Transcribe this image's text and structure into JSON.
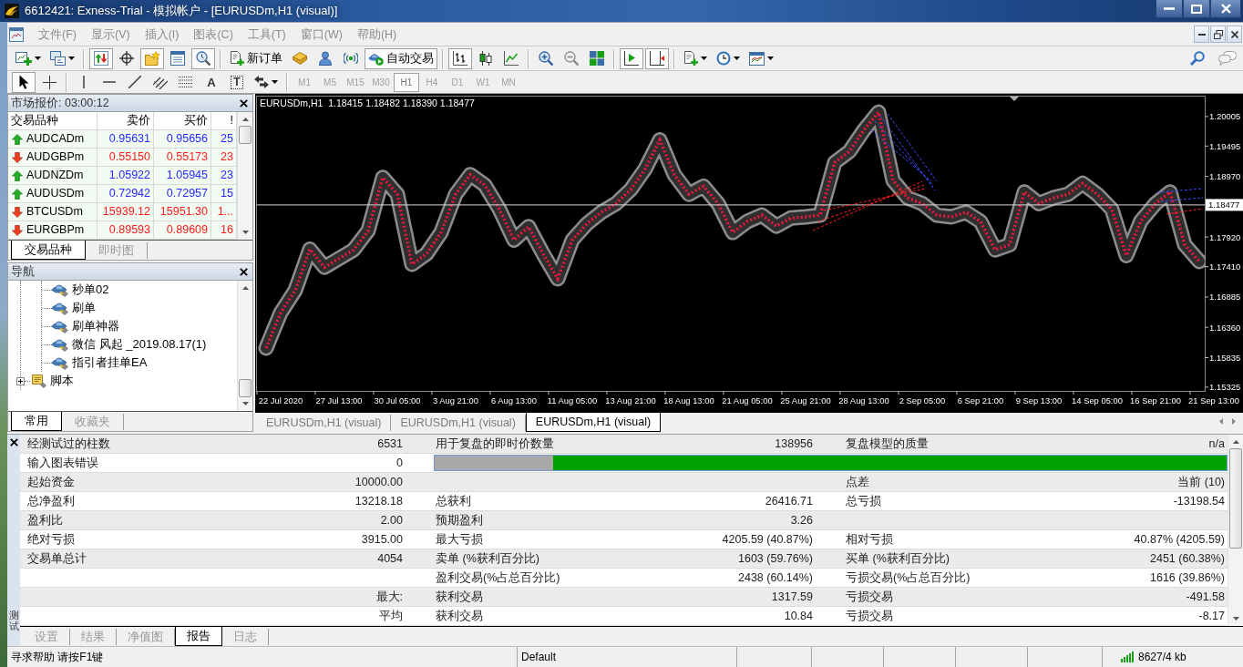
{
  "window": {
    "title": "6612421: Exness-Trial - 模拟帐户 - [EURUSDm,H1 (visual)]"
  },
  "menu": [
    "文件(F)",
    "显示(V)",
    "插入(I)",
    "图表(C)",
    "工具(T)",
    "窗口(W)",
    "帮助(H)"
  ],
  "toolbar": [
    [
      {
        "kind": "menu"
      },
      {
        "kind": "menu"
      }
    ],
    [
      {
        "kind": "toggle",
        "pressed": true
      },
      {
        "kind": "toggle",
        "pressed": false
      },
      {
        "kind": "toggle",
        "pressed": true
      },
      {
        "kind": "toggle",
        "pressed": false
      },
      {
        "kind": "toggle",
        "pressed": true
      }
    ],
    [
      {
        "kind": "button",
        "label": "新订单"
      },
      {
        "kind": "button"
      },
      {
        "kind": "button"
      },
      {
        "kind": "button"
      },
      {
        "kind": "toggle",
        "label": "自动交易",
        "pressed": true
      }
    ],
    [
      {
        "kind": "toggle",
        "pressed": true
      },
      {
        "kind": "toggle",
        "pressed": false
      },
      {
        "kind": "toggle",
        "pressed": false
      }
    ],
    [
      {
        "kind": "button"
      },
      {
        "kind": "button"
      },
      {
        "kind": "button"
      }
    ],
    [
      {
        "kind": "toggle",
        "pressed": true
      },
      {
        "kind": "toggle",
        "pressed": true
      }
    ],
    [
      {
        "kind": "menu"
      },
      {
        "kind": "menu"
      },
      {
        "kind": "menu"
      }
    ]
  ],
  "drawing_toolbar": {
    "tools": [
      [
        {
          "kind": "toggle",
          "pressed": true
        },
        {
          "kind": "toggle",
          "pressed": false
        }
      ],
      [
        {
          "kind": "button"
        },
        {
          "kind": "button"
        },
        {
          "kind": "button"
        },
        {
          "kind": "button"
        },
        {
          "kind": "button"
        },
        {
          "kind": "button",
          "label": "A"
        },
        {
          "kind": "button",
          "label": "T"
        },
        {
          "kind": "menu"
        }
      ]
    ],
    "periods": [
      {
        "label": "M1",
        "selected": false
      },
      {
        "label": "M5",
        "selected": false
      },
      {
        "label": "M15",
        "selected": false
      },
      {
        "label": "M30",
        "selected": false
      },
      {
        "label": "H1",
        "selected": true
      },
      {
        "label": "H4",
        "selected": false
      },
      {
        "label": "D1",
        "selected": false
      },
      {
        "label": "W1",
        "selected": false
      },
      {
        "label": "MN",
        "selected": false
      }
    ]
  },
  "market_watch": {
    "title": "市场报价: 03:00:12",
    "columns": [
      "交易品种",
      "卖价",
      "买价",
      "!"
    ],
    "rows": [
      {
        "symbol": "AUDCADm",
        "bid": "0.95631",
        "ask": "0.95656",
        "spread": "25",
        "rising": true
      },
      {
        "symbol": "AUDGBPm",
        "bid": "0.55150",
        "ask": "0.55173",
        "spread": "23",
        "rising": false
      },
      {
        "symbol": "AUDNZDm",
        "bid": "1.05922",
        "ask": "1.05945",
        "spread": "23",
        "rising": true
      },
      {
        "symbol": "AUDUSDm",
        "bid": "0.72942",
        "ask": "0.72957",
        "spread": "15",
        "rising": true
      },
      {
        "symbol": "BTCUSDm",
        "bid": "15939.12",
        "ask": "15951.30",
        "spread": "1...",
        "rising": false
      },
      {
        "symbol": "EURGBPm",
        "bid": "0.89593",
        "ask": "0.89609",
        "spread": "16",
        "rising": false
      }
    ],
    "tabs": [
      {
        "label": "交易品种",
        "selected": true
      },
      {
        "label": "即时图",
        "selected": false
      }
    ]
  },
  "navigator": {
    "title": "导航",
    "tree": [
      {
        "children": [
          {
            "label": "秒单02",
            "kind": "expert"
          },
          {
            "label": "刷单",
            "kind": "expert"
          },
          {
            "label": "刷单神器",
            "kind": "expert"
          },
          {
            "label": "微信 风起 _2019.08.17(1)",
            "kind": "expert"
          },
          {
            "label": "指引者挂单EA",
            "kind": "expert"
          }
        ]
      },
      {
        "label": "脚本",
        "kind": "script",
        "expanded": false
      }
    ],
    "tabs": [
      {
        "label": "常用",
        "selected": true
      },
      {
        "label": "收藏夹",
        "selected": false
      }
    ]
  },
  "chart": {
    "chart_data": {
      "type": "line",
      "title": "EURUSDm,H1  1.18415 1.18482 1.18390 1.18477",
      "categories": [
        null,
        "22 Jul 2020",
        null,
        null,
        null,
        "27 Jul 13:00",
        null,
        null,
        null,
        "30 Jul 05:00",
        null,
        null,
        null,
        "3 Aug 21:00",
        null,
        null,
        null,
        "6 Aug 13:00",
        null,
        null,
        null,
        "11 Aug 05:00",
        null,
        null,
        null,
        "13 Aug 21:00",
        null,
        null,
        null,
        "18 Aug 13:00",
        null,
        null,
        null,
        "21 Aug 05:00",
        null,
        null,
        null,
        "25 Aug 21:00",
        null,
        null,
        null,
        "28 Aug 13:00",
        null,
        null,
        null,
        "2 Sep 05:00",
        null,
        null,
        null,
        "6 Sep 21:00",
        null,
        null,
        null,
        "9 Sep 13:00",
        null,
        null,
        null,
        "14 Sep 05:00",
        null,
        null,
        null,
        "16 Sep 21:00",
        null,
        null,
        null,
        "21 Sep 13:00"
      ],
      "series": [
        {
          "color": "#e8173c",
          "line_style": "dashed",
          "values": [
            1.16,
            1.1661,
            1.17,
            1.1771,
            1.174,
            1.1755,
            1.177,
            1.1803,
            1.1895,
            1.1866,
            1.1745,
            1.1763,
            1.18,
            1.1866,
            1.19,
            1.1882,
            1.184,
            1.1787,
            1.181,
            1.1763,
            1.172,
            1.1787,
            1.1815,
            1.1835,
            1.185,
            1.1874,
            1.191,
            1.196,
            1.19,
            1.1866,
            1.188,
            1.185,
            1.18,
            1.1819,
            1.183,
            1.1811,
            1.1825,
            1.1827,
            1.183,
            1.1921,
            1.194,
            1.1977,
            1.2008,
            1.189,
            1.186,
            1.185,
            1.183,
            1.1827,
            1.1835,
            1.1819,
            1.177,
            1.1779,
            1.187,
            1.185,
            1.186,
            1.1866,
            1.1885,
            1.1866,
            1.184,
            1.176,
            1.182,
            1.185,
            1.187,
            1.1779,
            1.175,
            null
          ]
        }
      ],
      "ylim": [
        1.1526,
        1.2035
      ],
      "yticks": [
        {
          "value": 1.20005,
          "label": "1.20005"
        },
        {
          "value": 1.19495,
          "label": "1.19495"
        },
        {
          "value": 1.1897,
          "label": "1.18970"
        },
        {
          "value": 1.1792,
          "label": "1.17920"
        },
        {
          "value": 1.1741,
          "label": "1.17410"
        },
        {
          "value": 1.16885,
          "label": "1.16885"
        },
        {
          "value": 1.1636,
          "label": "1.16360"
        },
        {
          "value": 1.15835,
          "label": "1.15835"
        },
        {
          "value": 1.15325,
          "label": "1.15325"
        }
      ],
      "ref_lines": [
        {
          "axis": "y",
          "value": 1.18477,
          "label": "1.18477"
        }
      ]
    },
    "tabs": [
      {
        "label": "EURUSDm,H1 (visual)",
        "selected": false
      },
      {
        "label": "EURUSDm,H1 (visual)",
        "selected": false
      },
      {
        "label": "EURUSDm,H1 (visual)",
        "selected": true
      }
    ]
  },
  "tester": {
    "title": "测试",
    "report": [
      {
        "kind": "values",
        "column_1": "经测试过的柱数",
        "column_2": "6531",
        "column_3": "用于复盘的即时价数量",
        "column_4": "138956",
        "column_5": "复盘模型的质量",
        "column_6": "n/a"
      },
      {
        "kind": "bar",
        "column_1": "输入图表错误",
        "column_2": "0",
        "level": 0.85
      },
      {
        "kind": "values",
        "column_1": "起始资金",
        "column_2": "10000.00",
        "column_5": "点差",
        "column_6": "当前 (10)"
      },
      {
        "kind": "values",
        "column_1": "总净盈利",
        "column_2": "13218.18",
        "column_3": "总获利",
        "column_4": "26416.71",
        "column_5": "总亏损",
        "column_6": "-13198.54"
      },
      {
        "kind": "values",
        "column_1": "盈利比",
        "column_2": "2.00",
        "column_3": "预期盈利",
        "column_4": "3.26"
      },
      {
        "kind": "values",
        "column_1": "绝对亏损",
        "column_2": "3915.00",
        "column_3": "最大亏损",
        "column_4": "4205.59 (40.87%)",
        "column_5": "相对亏损",
        "column_6": "40.87% (4205.59)"
      },
      {
        "kind": "values",
        "column_1": "交易单总计",
        "column_2": "4054",
        "column_3": "卖单 (%获利百分比)",
        "column_4": "1603 (59.76%)",
        "column_5": "买单 (%获利百分比)",
        "column_6": "2451 (60.38%)"
      },
      {
        "kind": "values",
        "column_3": "盈利交易(%占总百分比)",
        "column_4": "2438 (60.14%)",
        "column_5": "亏损交易(%占总百分比)",
        "column_6": "1616 (39.86%)"
      },
      {
        "kind": "values",
        "column_2": "最大:",
        "column_3": "获利交易",
        "column_4": "1317.59",
        "column_5": "亏损交易",
        "column_6": "-491.58"
      },
      {
        "kind": "values",
        "column_2": "平均",
        "column_3": "获利交易",
        "column_4": "10.84",
        "column_5": "亏损交易",
        "column_6": "-8.17"
      }
    ],
    "tabs": [
      {
        "label": "设置",
        "selected": false
      },
      {
        "label": "结果",
        "selected": false
      },
      {
        "label": "净值图",
        "selected": false
      },
      {
        "label": "报告",
        "selected": true
      },
      {
        "label": "日志",
        "selected": false
      }
    ]
  },
  "status_bar": [
    "寻求帮助 请按F1键",
    "Default",
    "8627/4 kb"
  ]
}
